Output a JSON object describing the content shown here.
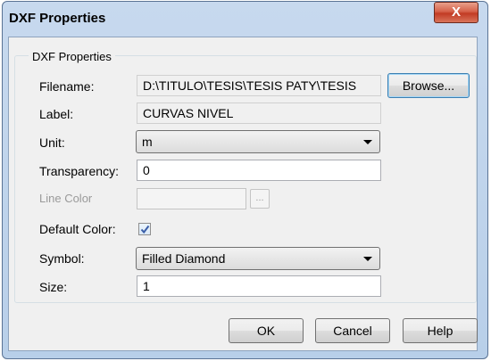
{
  "window": {
    "title": "DXF Properties",
    "close_label": "X"
  },
  "group": {
    "legend": "DXF Properties"
  },
  "fields": {
    "filename": {
      "label": "Filename:",
      "value": "D:\\TITULO\\TESIS\\TESIS PATY\\TESIS"
    },
    "label": {
      "label": "Label:",
      "value": "CURVAS NIVEL"
    },
    "unit": {
      "label": "Unit:",
      "value": "m"
    },
    "transparency": {
      "label": "Transparency:",
      "value": "0"
    },
    "line_color": {
      "label": "Line Color",
      "value": "",
      "ellipsis": "..."
    },
    "default_color": {
      "label": "Default Color:",
      "checked": true
    },
    "symbol": {
      "label": "Symbol:",
      "value": "Filled Diamond"
    },
    "size": {
      "label": "Size:",
      "value": "1"
    }
  },
  "buttons": {
    "browse": "Browse...",
    "ok": "OK",
    "cancel": "Cancel",
    "help": "Help"
  },
  "colors": {
    "title_bar": "#c7d9ee",
    "close_button": "#c23b24",
    "dialog_bg": "#f0f0f0",
    "checkmark": "#3a5ea8"
  }
}
